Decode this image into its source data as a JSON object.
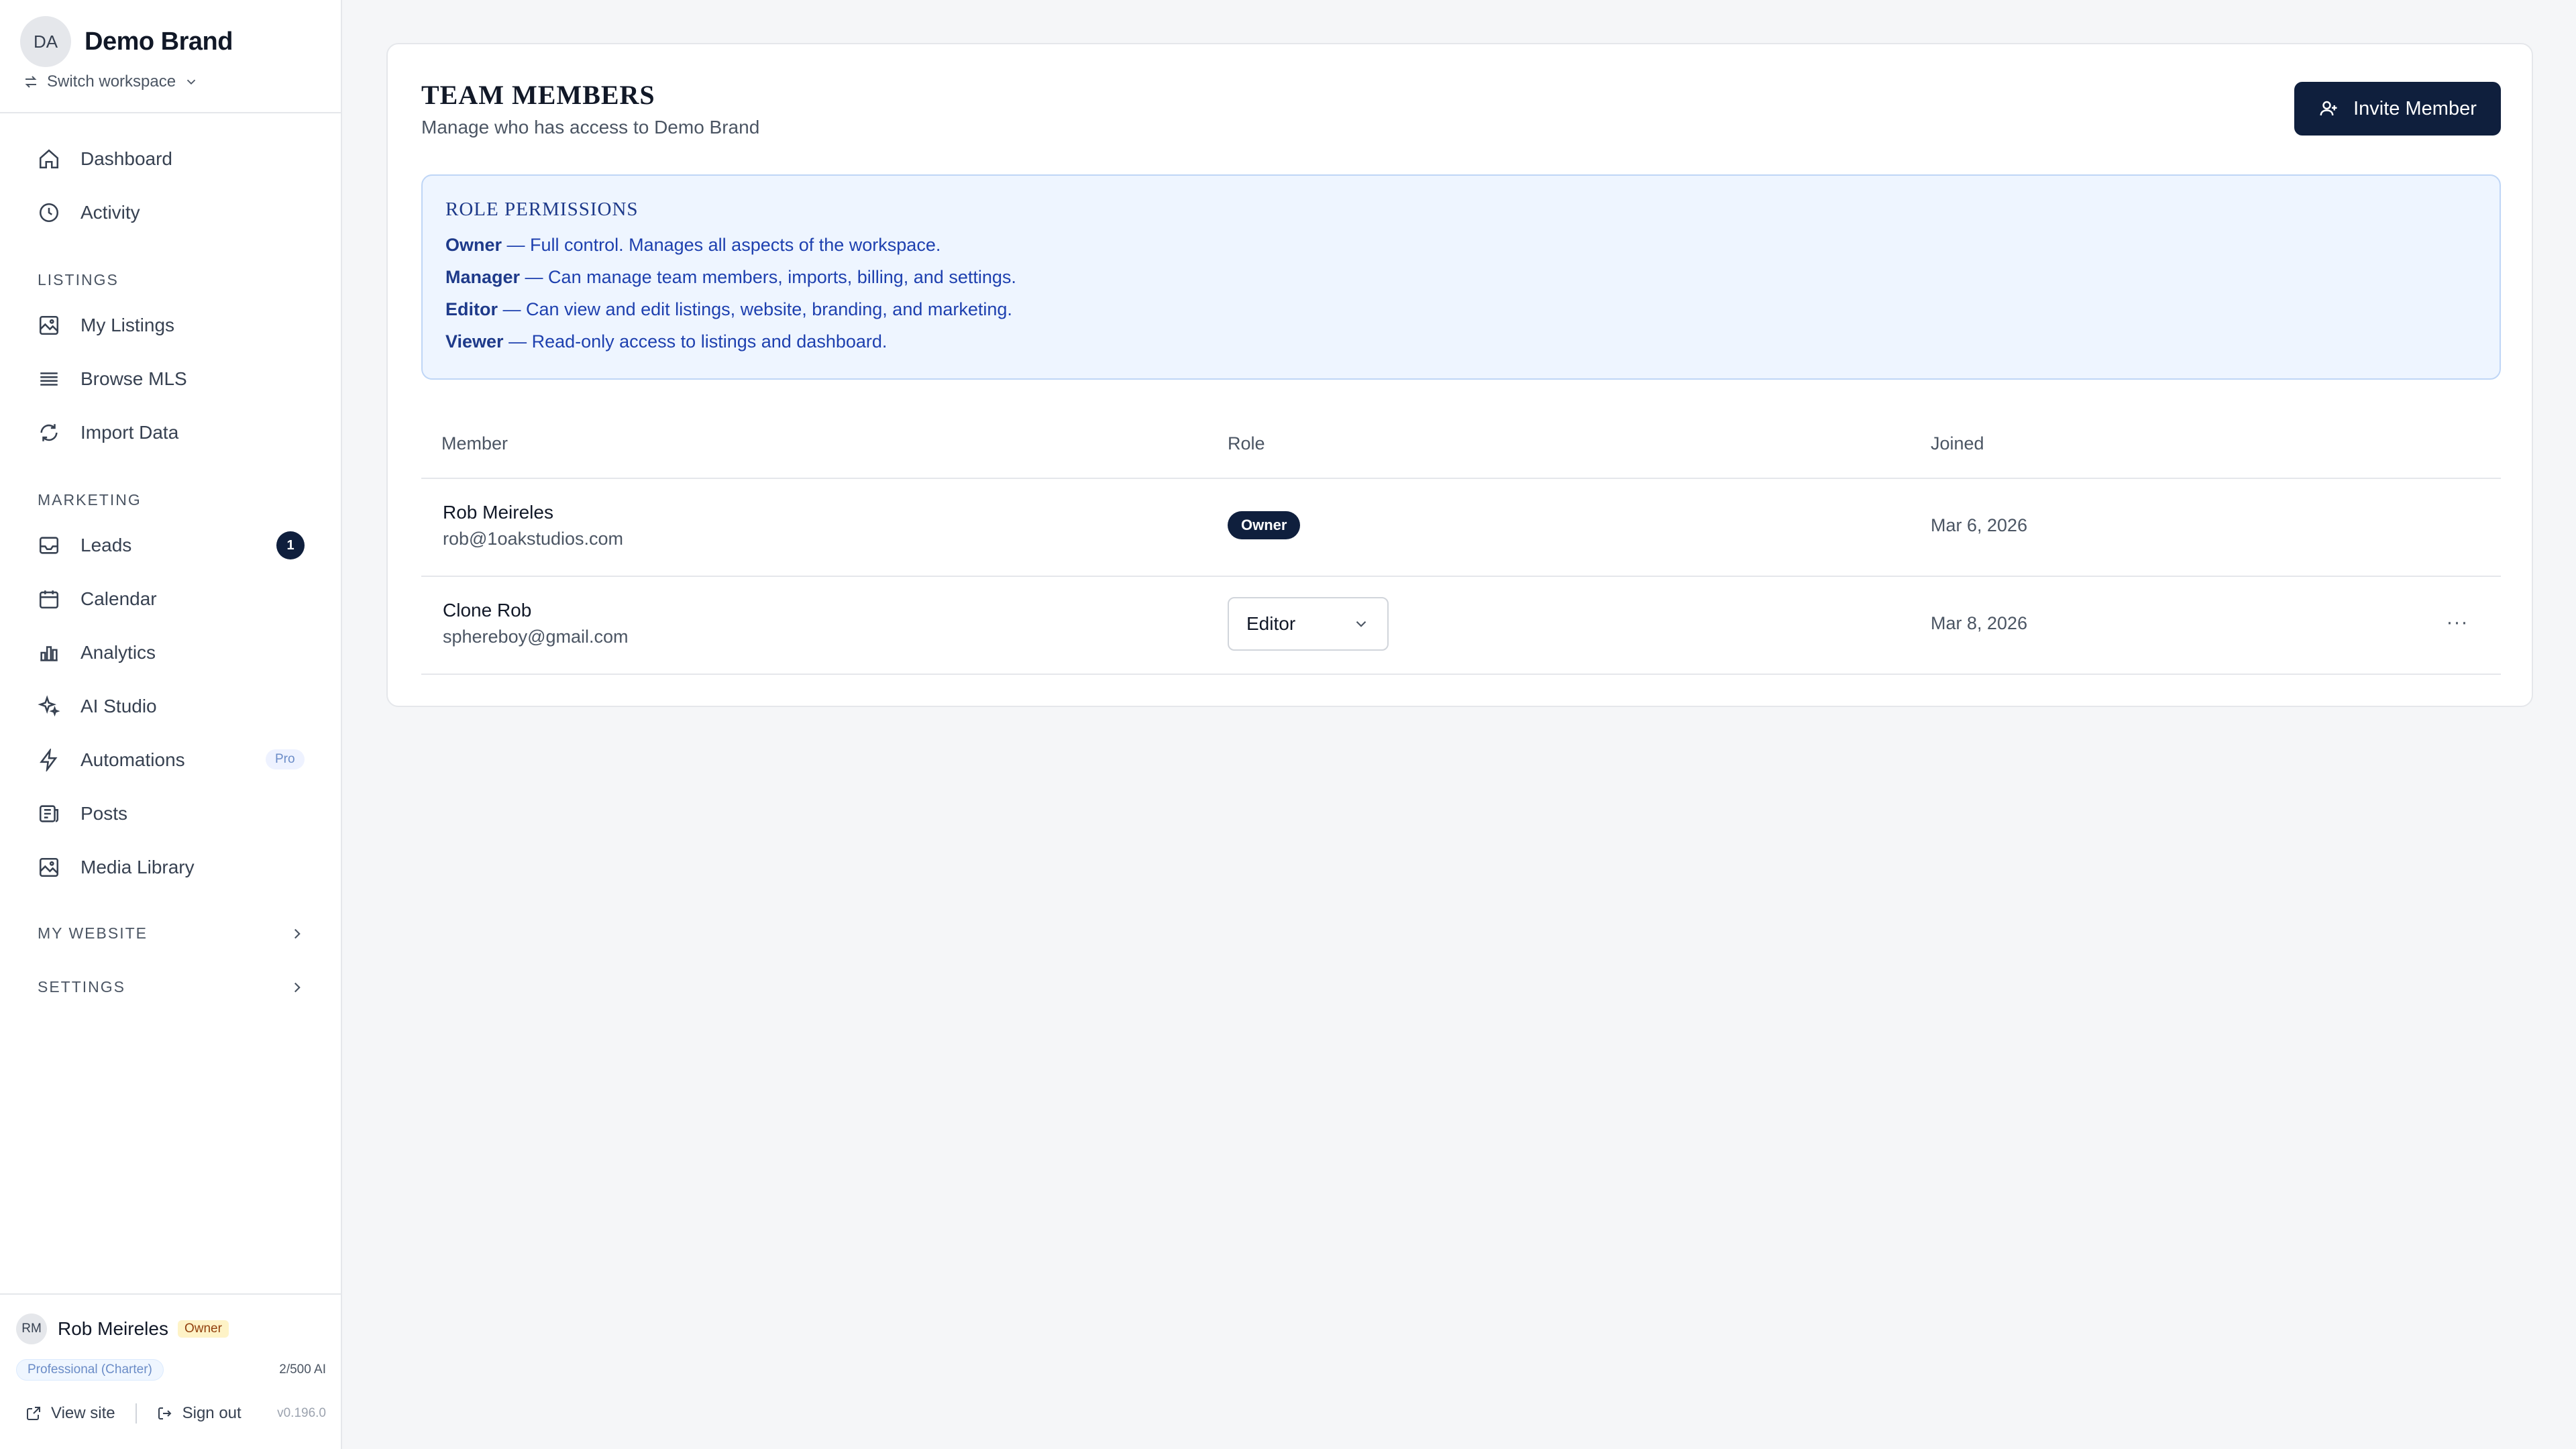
{
  "workspace": {
    "initials": "DA",
    "name": "Demo Brand",
    "switch_label": "Switch workspace"
  },
  "nav": {
    "dashboard": "Dashboard",
    "activity": "Activity",
    "listings_section": "LISTINGS",
    "my_listings": "My Listings",
    "browse_mls": "Browse MLS",
    "import_data": "Import Data",
    "marketing_section": "MARKETING",
    "leads": "Leads",
    "leads_count": "1",
    "calendar": "Calendar",
    "analytics": "Analytics",
    "ai_studio": "AI Studio",
    "automations": "Automations",
    "automations_badge": "Pro",
    "posts": "Posts",
    "media_library": "Media Library",
    "my_website": "MY WEBSITE",
    "settings": "SETTINGS"
  },
  "user": {
    "initials": "RM",
    "name": "Rob Meireles",
    "role": "Owner",
    "plan": "Professional (Charter)",
    "ai_usage": "2/500 AI",
    "view_site": "View site",
    "sign_out": "Sign out",
    "version": "v0.196.0"
  },
  "team": {
    "title": "TEAM MEMBERS",
    "subtitle": "Manage who has access to Demo Brand",
    "invite_label": "Invite Member",
    "permissions": {
      "title": "ROLE PERMISSIONS",
      "lines": [
        {
          "role": "Owner",
          "desc": " — Full control. Manages all aspects of the workspace."
        },
        {
          "role": "Manager",
          "desc": " — Can manage team members, imports, billing, and settings."
        },
        {
          "role": "Editor",
          "desc": " — Can view and edit listings, website, branding, and marketing."
        },
        {
          "role": "Viewer",
          "desc": " — Read-only access to listings and dashboard."
        }
      ]
    },
    "columns": {
      "member": "Member",
      "role": "Role",
      "joined": "Joined"
    },
    "members": [
      {
        "name": "Rob Meireles",
        "email": "rob@1oakstudios.com",
        "role": "Owner",
        "joined": "Mar 6, 2026"
      },
      {
        "name": "Clone Rob",
        "email": "sphereboy@gmail.com",
        "role": "Editor",
        "joined": "Mar 8, 2026",
        "more": "···"
      }
    ]
  }
}
